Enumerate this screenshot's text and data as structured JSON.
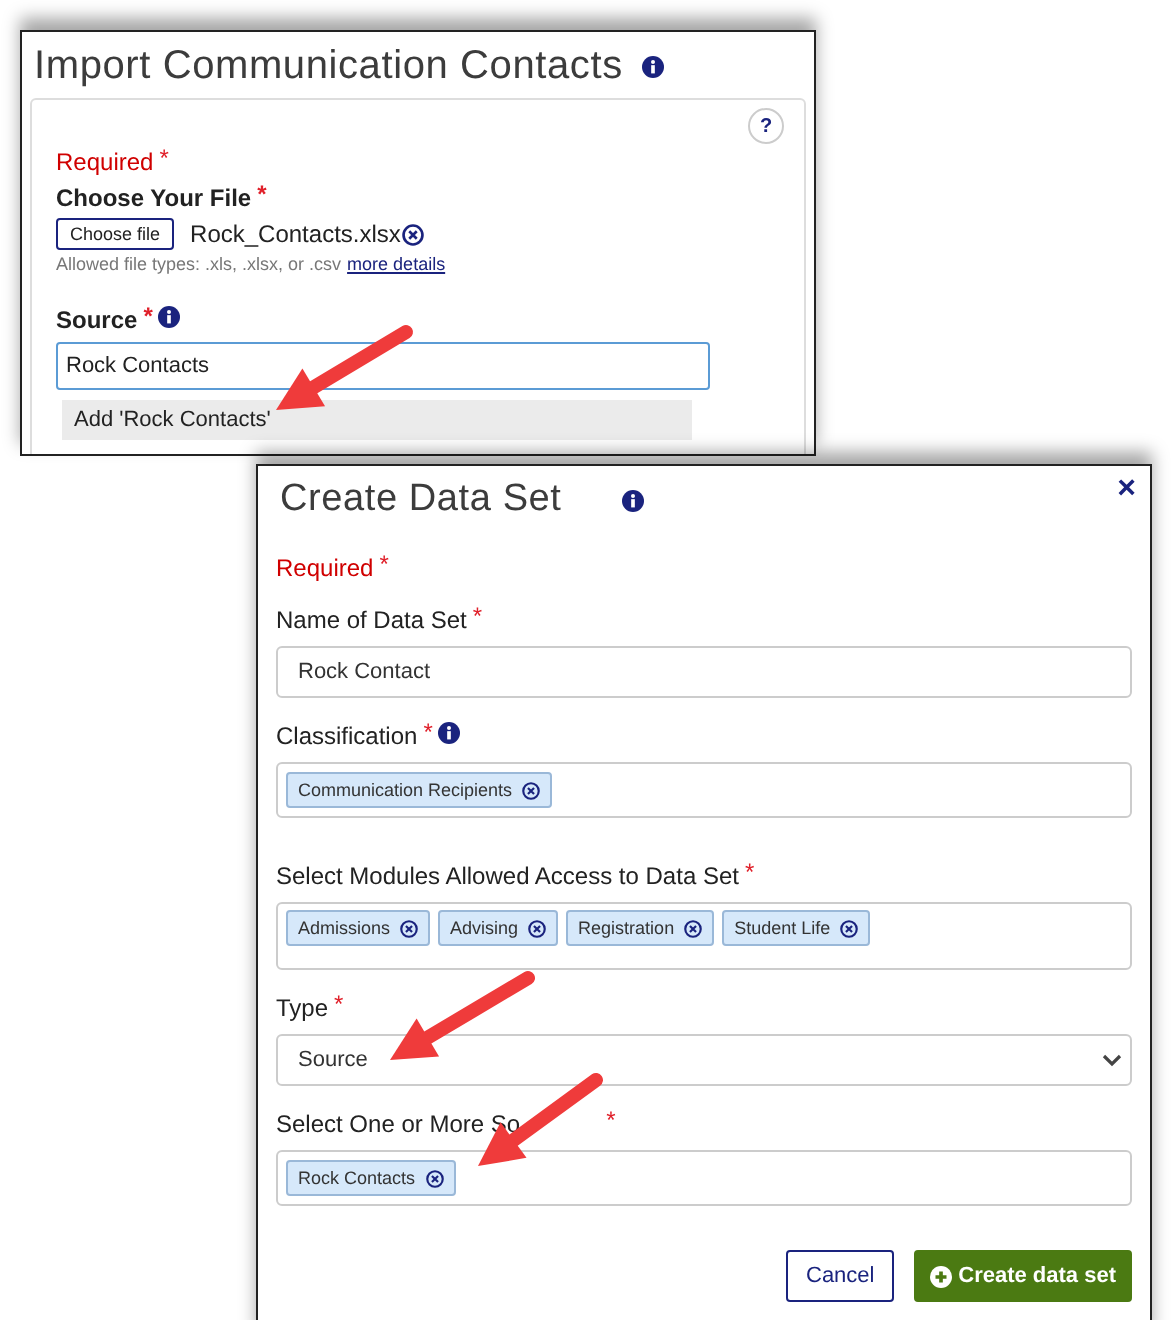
{
  "import_dialog": {
    "title": "Import Communication Contacts",
    "help": "?",
    "required": {
      "text": "Required",
      "mark": "*"
    },
    "file": {
      "label": "Choose Your File",
      "mark": "*",
      "button": "Choose file",
      "filename": "Rock_Contacts.xlsx",
      "hint": "Allowed file types: .xls, .xlsx, or .csv",
      "link": "more details"
    },
    "source": {
      "label": "Source",
      "mark": "*",
      "value": "Rock Contacts",
      "option": "Add 'Rock Contacts'"
    }
  },
  "create_dialog": {
    "title": "Create Data Set",
    "close": "×",
    "required": {
      "text": "Required",
      "mark": "*"
    },
    "fields": [
      {
        "kind": "text",
        "label": "Name of Data Set",
        "mark": "*",
        "info": false,
        "value": "Rock Contact"
      },
      {
        "kind": "tags",
        "label": "Classification",
        "mark": "*",
        "info": true,
        "tags": [
          "Communication Recipients"
        ]
      },
      {
        "kind": "tags",
        "label": "Select Modules Allowed Access to Data Set",
        "mark": "*",
        "info": false,
        "tags": [
          "Admissions",
          "Advising",
          "Registration",
          "Student Life"
        ]
      },
      {
        "kind": "select",
        "label": "Type",
        "mark": "*",
        "info": false,
        "value": "Source"
      },
      {
        "kind": "tags",
        "label": "Select One or More So",
        "mark": "*",
        "info": false,
        "tags": [
          "Rock Contacts"
        ]
      }
    ],
    "buttons": [
      {
        "kind": "secondary",
        "label": "Cancel"
      },
      {
        "kind": "primary",
        "label": "Create data set"
      }
    ]
  }
}
